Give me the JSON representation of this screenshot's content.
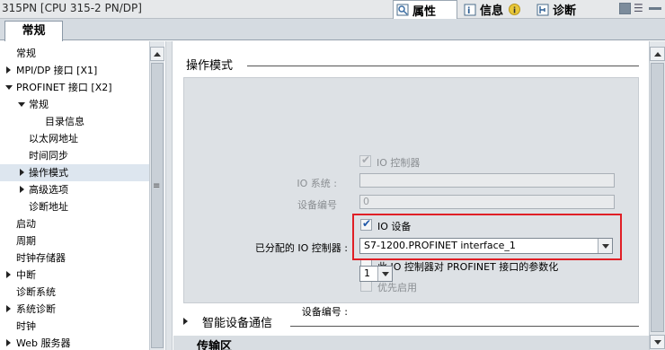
{
  "window": {
    "title": "315PN [CPU 315-2 PN/DP]",
    "tabs": [
      {
        "label": "属性"
      },
      {
        "label": "信息"
      },
      {
        "label": "诊断"
      }
    ]
  },
  "subtab": {
    "label": "常规"
  },
  "tree": {
    "items": [
      {
        "label": "常规"
      },
      {
        "label": "MPI/DP 接口 [X1]"
      },
      {
        "label": "PROFINET 接口 [X2]"
      },
      {
        "label": "常规"
      },
      {
        "label": "目录信息"
      },
      {
        "label": "以太网地址"
      },
      {
        "label": "时间同步"
      },
      {
        "label": "操作模式"
      },
      {
        "label": "高级选项"
      },
      {
        "label": "诊断地址"
      },
      {
        "label": "启动"
      },
      {
        "label": "周期"
      },
      {
        "label": "时钟存储器"
      },
      {
        "label": "中断"
      },
      {
        "label": "诊断系统"
      },
      {
        "label": "系统诊断"
      },
      {
        "label": "时钟"
      },
      {
        "label": "Web 服务器"
      }
    ]
  },
  "operation_mode": {
    "title": "操作模式",
    "io_controller": {
      "label": "IO 控制器",
      "checked": true,
      "disabled": true
    },
    "io_system": {
      "label": "IO 系统 :",
      "value": ""
    },
    "device_number_top": {
      "label": "设备编号",
      "value": "0"
    },
    "io_device": {
      "label": "IO 设备",
      "checked": true
    },
    "assigned_controller": {
      "label": "已分配的 IO 控制器 :",
      "value": "S7-1200.PROFINET interface_1"
    },
    "param_option": {
      "label": "此 IO 控制器对 PROFINET 接口的参数化",
      "checked": false
    },
    "priority_option": {
      "label": "优先启用",
      "checked": false,
      "disabled": true
    },
    "device_number": {
      "label": "设备编号 :",
      "value": "1"
    }
  },
  "sections": {
    "smart_device": "智能设备通信",
    "transfer_area": "传输区"
  },
  "colors": {
    "highlight": "#e01f26",
    "panel": "#dde1e5",
    "checkbox_blue": "#1f57a8"
  }
}
